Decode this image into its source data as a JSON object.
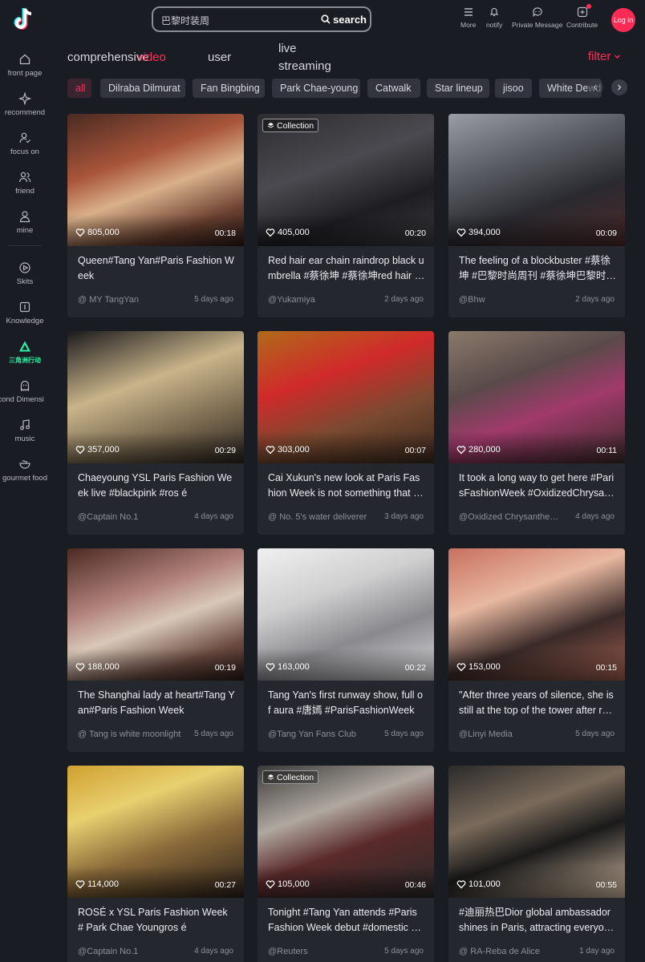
{
  "header": {
    "search_value": "巴黎时装周",
    "search_label": "search",
    "items": [
      {
        "label": "More",
        "icon": "menu-icon"
      },
      {
        "label": "notify",
        "icon": "bell-icon"
      },
      {
        "label": "Private Message",
        "icon": "message-icon"
      },
      {
        "label": "Contribute",
        "icon": "plus-icon"
      }
    ],
    "login_label": "Log in"
  },
  "sidebar": {
    "items": [
      {
        "label": "front page",
        "icon": "home-icon"
      },
      {
        "label": "recommend",
        "icon": "sparkle-icon"
      },
      {
        "label": "focus on",
        "icon": "follow-icon"
      },
      {
        "label": "friend",
        "icon": "friends-icon"
      },
      {
        "label": "mine",
        "icon": "user-icon"
      },
      {
        "label": "Skits",
        "icon": "play-icon"
      },
      {
        "label": "Knowledge",
        "icon": "book-icon"
      },
      {
        "label": "三角洲行动",
        "icon": "delta-icon"
      },
      {
        "label": "cond Dimensi",
        "icon": "ghost-icon"
      },
      {
        "label": "music",
        "icon": "music-icon"
      },
      {
        "label": "gourmet food",
        "icon": "food-icon"
      }
    ]
  },
  "tabs": {
    "comprehensive": "comprehensive",
    "video": "video",
    "user": "user",
    "live_line1": "live",
    "live_line2": "streaming",
    "filter": "filter"
  },
  "chips": [
    "all",
    "Dilraba Dilmurat",
    "Fan Bingbing",
    "Park Chae-young",
    "Catwalk",
    "Star lineup",
    "jisoo",
    "White Dewdrop"
  ],
  "colors": {
    "accent": "#fe2c55",
    "background": "#1a1c24",
    "card": "#25272f",
    "special_green": "#2cf1a4"
  },
  "cards": [
    {
      "likes": "805,000",
      "duration": "00:18",
      "title": "Queen#Tang Yan#Paris Fashion Week",
      "author": "@  MY TangYan",
      "date": "5 days ago",
      "badge": ""
    },
    {
      "likes": "405,000",
      "duration": "00:20",
      "title": "Red hair ear chain raindrop black umbrella #蔡徐坤 #蔡徐坤red hair #蔡徐坤",
      "author": "@Yukamiya",
      "date": "2 days ago",
      "badge": "Collection"
    },
    {
      "likes": "394,000",
      "duration": "00:09",
      "title": "The feeling of a blockbuster #蔡徐坤 #巴黎时尚周刊 #蔡徐坤巴黎时装周",
      "author": "@Bhw",
      "date": "2 days ago",
      "badge": ""
    },
    {
      "likes": "357,000",
      "duration": "00:29",
      "title": "Chaeyoung YSL Paris Fashion Week live #blackpink #ros é",
      "author": "@Captain  No.1",
      "date": "4 days ago",
      "badge": ""
    },
    {
      "likes": "303,000",
      "duration": "00:07",
      "title": "Cai Xukun's new look at Paris Fashion Week is not something that anyone can pull off",
      "author": "@  No. 5's water deliverer",
      "date": "3 days ago",
      "badge": ""
    },
    {
      "likes": "280,000",
      "duration": "00:11",
      "title": "It took a long way to get here #ParisFashionWeek #OxidizedChrysanthemum",
      "author": "@Oxidized  Chrysanthemum",
      "date": "4 days ago",
      "badge": ""
    },
    {
      "likes": "188,000",
      "duration": "00:19",
      "title": "The Shanghai lady at heart#Tang Yan#Paris Fashion Week",
      "author": "@  Tang is white moonlight",
      "date": "5 days ago",
      "badge": ""
    },
    {
      "likes": "163,000",
      "duration": "00:22",
      "title": "Tang Yan's first runway show, full of aura #唐嫣 #ParisFashionWeek",
      "author": "@Tang  Yan Fans Club",
      "date": "5 days ago",
      "badge": ""
    },
    {
      "likes": "153,000",
      "duration": "00:15",
      "title": "\"After three years of silence, she is still at the top of the tower after returning\"",
      "author": "@Linyi  Media",
      "date": "5 days ago",
      "badge": ""
    },
    {
      "likes": "114,000",
      "duration": "00:27",
      "title": "ROSÉ x YSL Paris Fashion Week # Park Chae Youngros é",
      "author": "@Captain  No.1",
      "date": "4 days ago",
      "badge": ""
    },
    {
      "likes": "105,000",
      "duration": "00:46",
      "title": "Tonight #Tang Yan attends #Paris Fashion Week debut #domestic actress",
      "author": "@Reuters",
      "date": "5 days ago",
      "badge": "Collection"
    },
    {
      "likes": "101,000",
      "duration": "00:55",
      "title": "#迪丽热巴Dior global ambassador shines in Paris, attracting everyone's attention",
      "author": "@  RA-Reba de Alice",
      "date": "1 day ago",
      "badge": ""
    }
  ]
}
